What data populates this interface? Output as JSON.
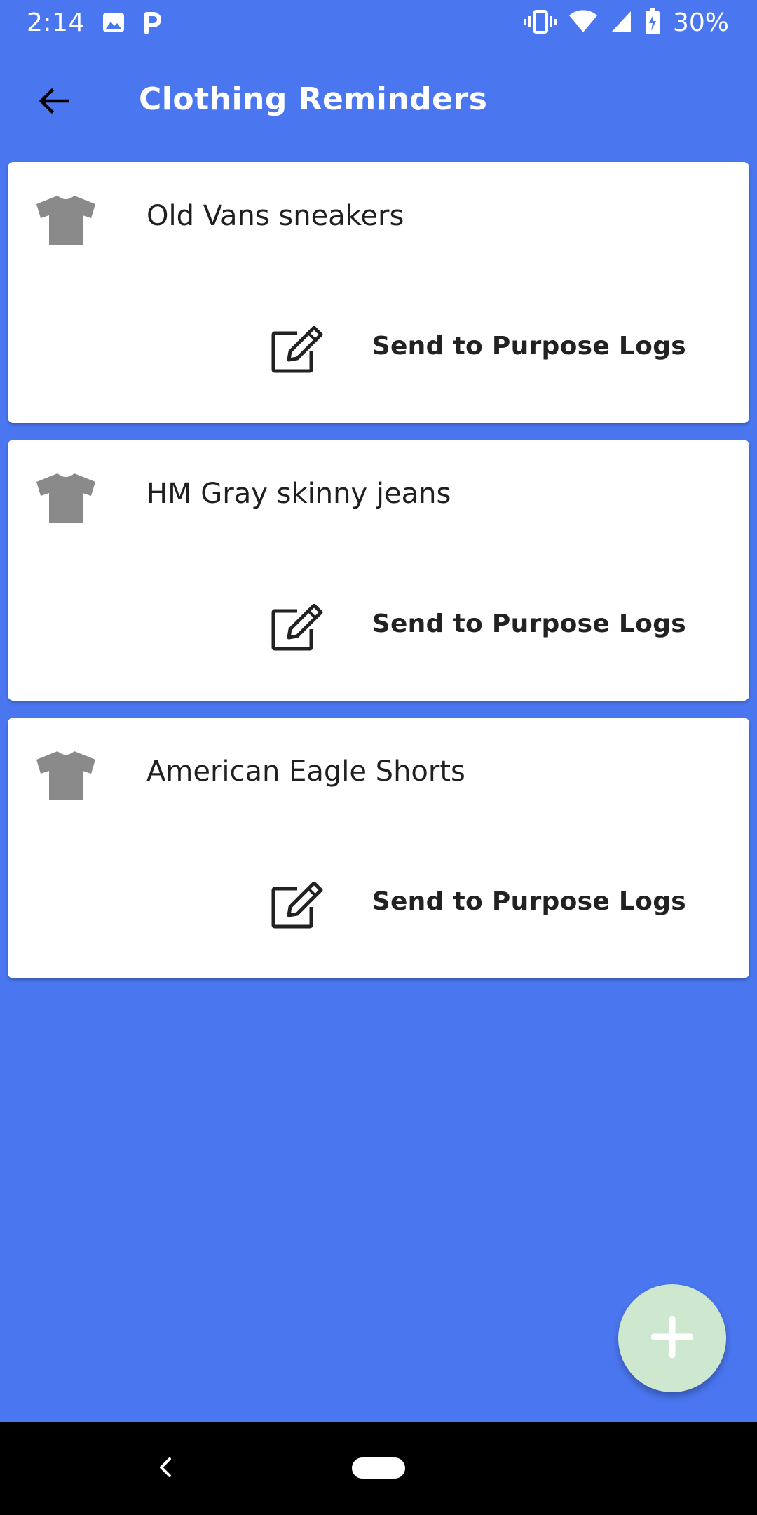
{
  "status_bar": {
    "time": "2:14",
    "battery": "30%",
    "icons": [
      "image-icon",
      "parking-app-icon",
      "vibrate-icon",
      "wifi-icon",
      "signal-icon",
      "battery-charging-icon"
    ]
  },
  "app_bar": {
    "title": "Clothing Reminders",
    "back_icon": "arrow-back-icon"
  },
  "reminders": [
    {
      "name": "Old Vans sneakers",
      "action_label": "Send to Purpose Logs",
      "icon": "tshirt-icon",
      "edit_icon": "edit-icon"
    },
    {
      "name": "HM Gray skinny jeans",
      "action_label": "Send to Purpose Logs",
      "icon": "tshirt-icon",
      "edit_icon": "edit-icon"
    },
    {
      "name": "American Eagle Shorts",
      "action_label": "Send to Purpose Logs",
      "icon": "tshirt-icon",
      "edit_icon": "edit-icon"
    }
  ],
  "fab": {
    "icon": "plus-icon"
  },
  "colors": {
    "background": "#4A76F0",
    "card": "#FFFFFF",
    "shirt_icon": "#8A8A8A",
    "fab": "#CDE8CF"
  }
}
